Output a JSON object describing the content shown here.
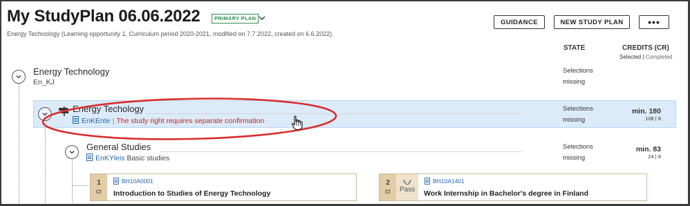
{
  "header": {
    "title": "My StudyPlan 06.06.2022",
    "badge": "PRIMARY PLAN",
    "subtitle": "Energy Technology (Learning opportunity 1, Curriculum period 2020-2021, modified on 7.7.2022, created on 6.6.2022)"
  },
  "toolbar": {
    "guidance_label": "GUIDANCE",
    "new_plan_label": "NEW STUDY PLAN",
    "more_label": "•••"
  },
  "columns": {
    "state": "STATE",
    "credits": "CREDITS (CR)",
    "credits_sub_selected": "Selected",
    "credits_sub_sep": "|",
    "credits_sub_completed": "Completed"
  },
  "tree": {
    "root": {
      "title": "Energy Technology",
      "code": "En_KJ",
      "state_line1": "Selections",
      "state_line2": "missing"
    },
    "module": {
      "title": "Energy Techology",
      "code": "EnKEnte",
      "separator": "|",
      "warning": "The study right requires separate confirmation",
      "state_line1": "Selections",
      "state_line2": "missing",
      "credits_main": "min. 180",
      "credits_selected": "108",
      "credits_sep": "|",
      "credits_completed": "8"
    },
    "submodule": {
      "title": "General Studies",
      "code": "EnKYleis",
      "code_desc": "Basic studies",
      "state_line1": "Selections",
      "state_line2": "missing",
      "credits_main": "min. 83",
      "credits_selected": "24",
      "credits_sep": "|",
      "credits_completed": "8"
    }
  },
  "courses": [
    {
      "credits": "1",
      "unit": "cr",
      "code": "BH10A0001",
      "title": "Introduction to Studies of Energy Technology"
    },
    {
      "credits": "2",
      "unit": "cr",
      "grade": "Pass",
      "code": "BH10A1401",
      "title": "Work Internship in Bachelor's degree in Finland"
    }
  ],
  "icons": {
    "chevron": "chevron-down-icon",
    "document": "document-icon",
    "signpost": "signpost-icon",
    "laurel": "laurel-icon",
    "cursor": "hand-cursor-icon"
  },
  "colors": {
    "accent_link": "#2165b1",
    "warning": "#c2261f",
    "badge_green": "#2e8b4f",
    "highlight_row": "#dcebf9",
    "annotation_red": "#d92b2b",
    "course_credit_bg": "#e3cda7"
  }
}
